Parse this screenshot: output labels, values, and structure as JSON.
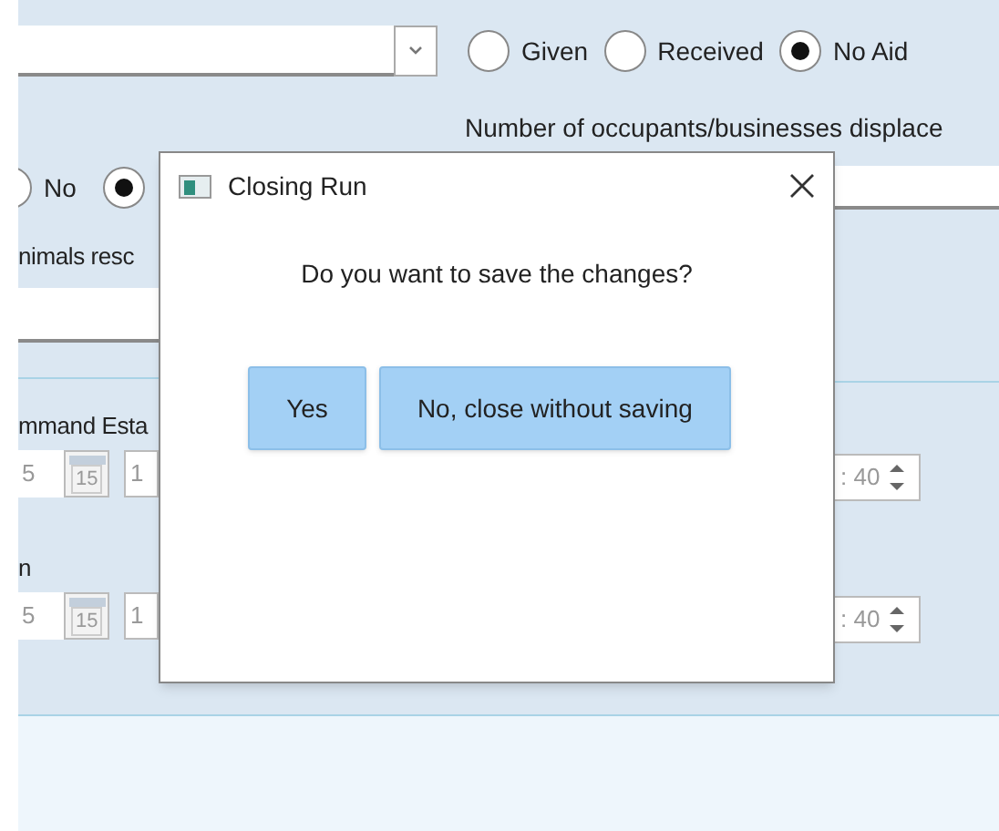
{
  "aid_options": [
    {
      "label": "Given",
      "selected": false
    },
    {
      "label": "Received",
      "selected": false
    },
    {
      "label": "No Aid",
      "selected": true
    }
  ],
  "displaced_label": "Number of occupants/businesses displace",
  "yes_no": [
    {
      "label": "No",
      "selected": false
    },
    {
      "selected": true
    }
  ],
  "animals_label": "nimals resc",
  "date_rows": [
    {
      "label": "mmand Esta",
      "date": "5",
      "calendar_day": "15",
      "hour": "1",
      "minutes": ": 40"
    },
    {
      "label": "n",
      "date": "5",
      "calendar_day": "15",
      "hour": "1",
      "minutes": ": 40"
    }
  ],
  "dialog": {
    "title": "Closing Run",
    "message": "Do you want to save the changes?",
    "buttons": [
      {
        "label": "Yes"
      },
      {
        "label": "No, close without saving"
      }
    ]
  }
}
